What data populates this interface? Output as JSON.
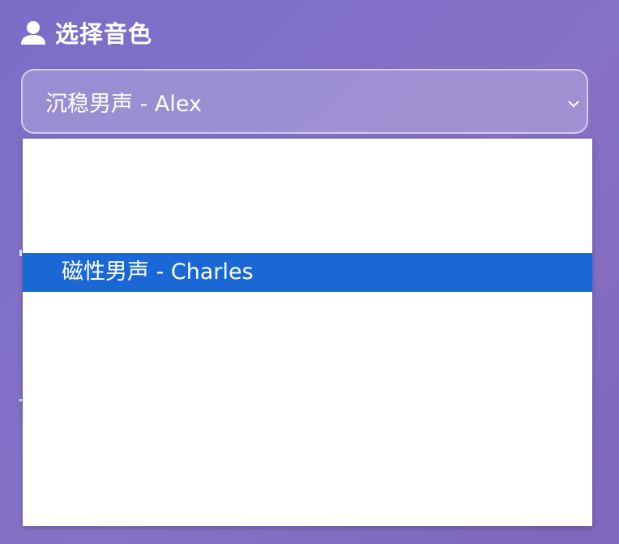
{
  "section": {
    "icon": "user-icon",
    "title": "选择音色"
  },
  "voice_select": {
    "selected_value": "沉稳男声 - Alex",
    "chevron_icon": "chevron-down-icon"
  },
  "dropdown": {
    "options": [
      {
        "label": "磁性男声 - Charles",
        "highlighted": true
      }
    ],
    "highlight_color": "#1a68d6"
  }
}
